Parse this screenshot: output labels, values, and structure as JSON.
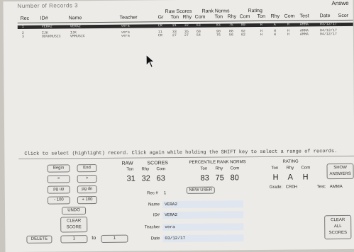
{
  "table": {
    "title": "Number of Records 3",
    "answers_label": "Answe",
    "groups": {
      "raw": "Raw Scores",
      "norms": "Rank Norms",
      "rating": "Rating"
    },
    "columns": [
      "Rec",
      "ID#",
      "Name",
      "Teacher",
      "Gr",
      "Ton",
      "Rhy",
      "Com",
      "Ton",
      "Rhy",
      "Com",
      "Ton",
      "Rhy",
      "Com",
      "Test",
      "Date",
      "Scor"
    ],
    "rows": [
      {
        "rec": "1",
        "id": "VERA2",
        "name": "VERA2",
        "teacher": "vera",
        "gr": "CR",
        "t": "31",
        "r": "32",
        "c": "63",
        "nt": "83",
        "nr": "75",
        "nc": "80",
        "rt": "H",
        "rr": "A",
        "rc": "H",
        "test": "AMMA",
        "date": "03/12/17"
      },
      {
        "rec": "2",
        "id": "IJK",
        "name": "IJK",
        "teacher": "vera",
        "gr": "11",
        "t": "33",
        "r": "35",
        "c": "68",
        "nt": "90",
        "nr": "88",
        "nc": "92",
        "rt": "H",
        "rr": "H",
        "rc": "H",
        "test": "AMMA",
        "date": "04/12/17"
      },
      {
        "rec": "3",
        "id": "ODVKMUSIC",
        "name": "VMMUSIC",
        "teacher": "vera",
        "gr": "CR",
        "t": "27",
        "r": "27",
        "c": "54",
        "nt": "76",
        "nr": "56",
        "nc": "62",
        "rt": "H",
        "rr": "H",
        "rc": "H",
        "test": "AMMA",
        "date": "04/12/17"
      }
    ]
  },
  "status_line": "Click to select (highlight) record.  Click again while holding the SHIFT key to select a range of records.",
  "buttons": {
    "begin": "Begin",
    "end": "End",
    "prev": "<",
    "next": ">",
    "pgup": "pg up",
    "pgdn": "pg dn",
    "minus100": "- 100",
    "plus100": "+ 100",
    "undo": "UNDO",
    "clear_score": [
      "CLEAR",
      "SCORE"
    ],
    "new_user": "NEW USER",
    "show_answers": [
      "SHOW",
      "ANSWERS"
    ],
    "clear_all_scores": [
      "CLEAR",
      "ALL",
      "SCORES"
    ],
    "delete": "DELETE",
    "range_to": "to",
    "range_from_value": "1",
    "range_to_value": "1"
  },
  "raw_scores": {
    "heading_raw": "RAW",
    "heading_scores": "SCORES",
    "labels": [
      "Ton",
      "Rhy",
      "Com"
    ],
    "values": [
      "31",
      "32",
      "63"
    ]
  },
  "norms": {
    "heading": "PERCENTILE RANK NORMS",
    "labels": [
      "Ton",
      "Rhy",
      "Com"
    ],
    "values": [
      "83",
      "75",
      "80"
    ]
  },
  "rating": {
    "heading": "RATING",
    "labels": [
      "Ton",
      "Rhy",
      "Com"
    ],
    "values": [
      "H",
      "A",
      "H"
    ],
    "grade_label": "Grade:",
    "grade_value": "CR0H",
    "test_label": "Test:",
    "test_value": "AMMA"
  },
  "record": {
    "rec_label": "Rec #",
    "rec_value": "1",
    "name_label": "Name",
    "name_value": "VERA2",
    "id_label": "ID#",
    "id_value": "VERA2",
    "teacher_label": "Teacher",
    "teacher_value": "vera",
    "date_label": "Date",
    "date_value": "03/12/17"
  }
}
